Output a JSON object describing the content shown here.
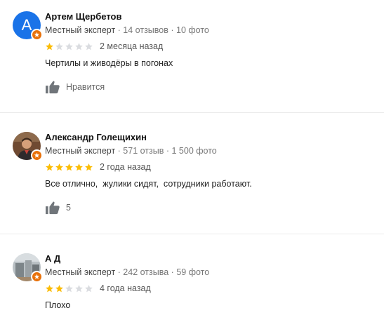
{
  "reviews": [
    {
      "author": "Артем Щербетов",
      "avatar_letter": "A",
      "avatar_color": "#1a73e8",
      "role": "Местный эксперт",
      "reviews_count": "14 отзывов",
      "photos_count": "10 фото",
      "rating": 1,
      "date": "2 месяца назад",
      "text": "Чертилы и живодёры в погонах",
      "like_label": "Нравится"
    },
    {
      "author": "Александр Голещихин",
      "avatar_letter": "",
      "avatar_color": "#8a5a3c",
      "role": "Местный эксперт",
      "reviews_count": "571 отзыв",
      "photos_count": "1 500 фото",
      "rating": 5,
      "date": "2 года назад",
      "text": "Все отлично,  жулики сидят,  сотрудники работают.",
      "like_label": "5"
    },
    {
      "author": "А Д",
      "avatar_letter": "",
      "avatar_color": "#9aa3a8",
      "role": "Местный эксперт",
      "reviews_count": "242 отзыва",
      "photos_count": "59 фото",
      "rating": 2,
      "date": "4 года назад",
      "text": "Плохо",
      "like_label": ""
    }
  ],
  "meta_separator": " · ",
  "colors": {
    "star_filled": "#fbbc04",
    "star_empty": "#dadce0",
    "badge": "#e8710a",
    "like_icon": "#70757a"
  }
}
